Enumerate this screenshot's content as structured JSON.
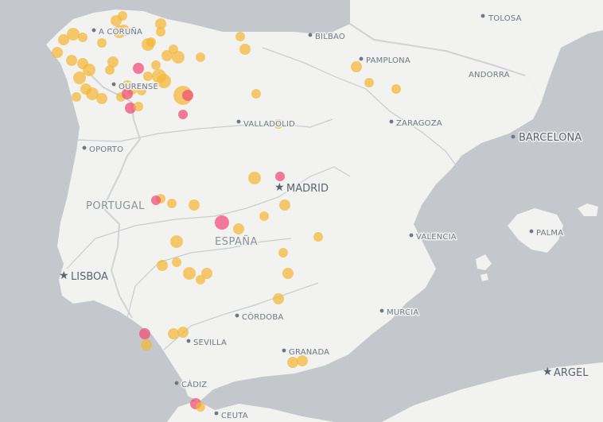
{
  "map": {
    "colors": {
      "sea": "#c4c8cc",
      "land": "#f2f2f0",
      "border": "#d0d2d4",
      "river": "#c8ccd0",
      "fire_large": "#f5b731",
      "fire_active": "#f0507a"
    },
    "cities": [
      {
        "name": "TOLOSA",
        "marker": "dot"
      },
      {
        "name": "BILBAO",
        "marker": "dot"
      },
      {
        "name": "PAMPLONA",
        "marker": "dot"
      },
      {
        "name": "ANDORRA",
        "marker": "none"
      },
      {
        "name": "A CORUÑA",
        "marker": "dot"
      },
      {
        "name": "OURENSE",
        "marker": "dot"
      },
      {
        "name": "VALLADOLID",
        "marker": "dot"
      },
      {
        "name": "ZARAGOZA",
        "marker": "dot"
      },
      {
        "name": "BARCELONA",
        "marker": "dot"
      },
      {
        "name": "OPORTO",
        "marker": "dot"
      },
      {
        "name": "MADRID",
        "marker": "star"
      },
      {
        "name": "PORTUGAL",
        "marker": "country"
      },
      {
        "name": "ESPAÑA",
        "marker": "country"
      },
      {
        "name": "PALMA",
        "marker": "dot"
      },
      {
        "name": "VALENCIA",
        "marker": "dot"
      },
      {
        "name": "LISBOA",
        "marker": "star"
      },
      {
        "name": "MURCIA",
        "marker": "dot"
      },
      {
        "name": "CÓRDOBA",
        "marker": "dot"
      },
      {
        "name": "SEVILLA",
        "marker": "dot"
      },
      {
        "name": "GRANADA",
        "marker": "dot"
      },
      {
        "name": "CÁDIZ",
        "marker": "dot"
      },
      {
        "name": "ARGEL",
        "marker": "star"
      },
      {
        "name": "CEUTA",
        "marker": "dot"
      }
    ]
  }
}
